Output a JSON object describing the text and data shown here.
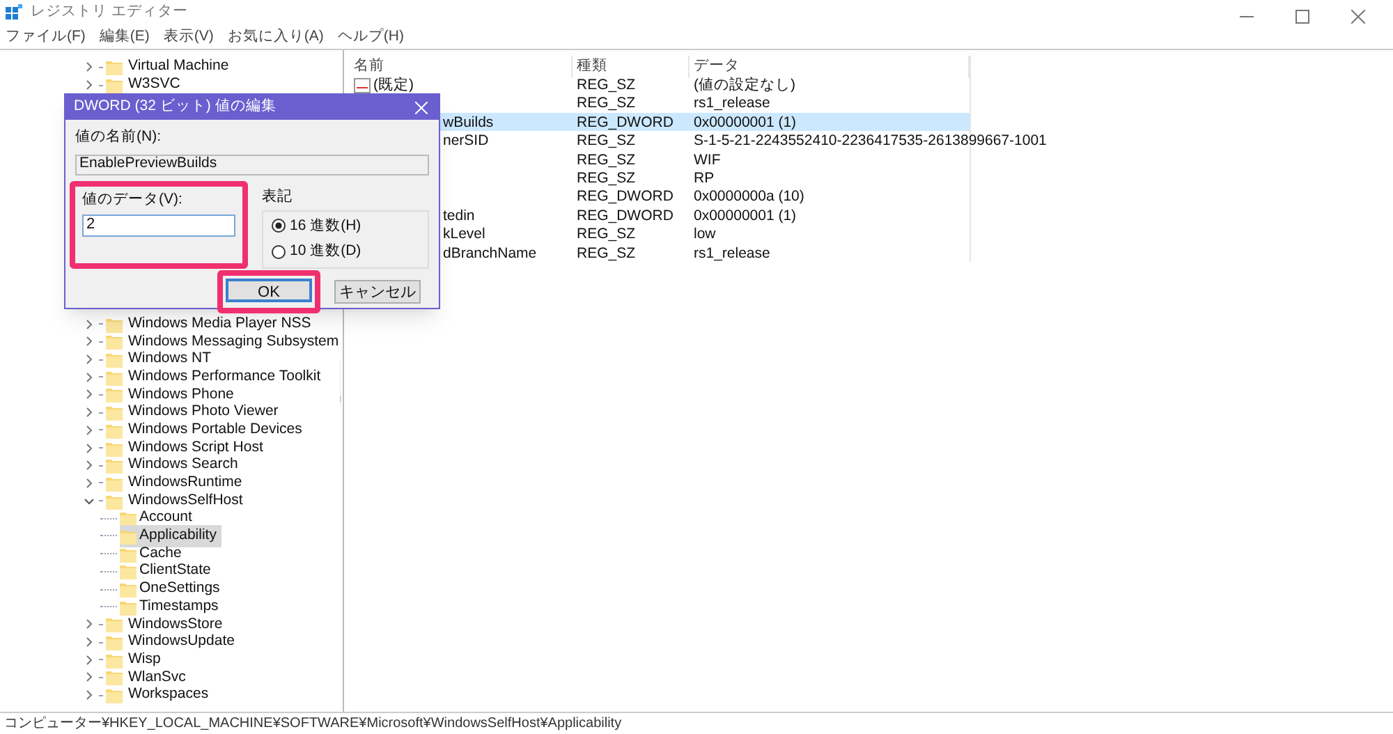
{
  "window": {
    "title": "レジストリ エディター"
  },
  "menu": [
    "ファイル(F)",
    "編集(E)",
    "表示(V)",
    "お気に入り(A)",
    "ヘルプ(H)"
  ],
  "tree": {
    "top_items": [
      {
        "label": "Virtual Machine",
        "expanded": false
      },
      {
        "label": "W3SVC",
        "expanded": false
      }
    ],
    "items": [
      {
        "label": "Windows Media Player NSS",
        "expanded": false
      },
      {
        "label": "Windows Messaging Subsystem",
        "expanded": false
      },
      {
        "label": "Windows NT",
        "expanded": false
      },
      {
        "label": "Windows Performance Toolkit",
        "expanded": false
      },
      {
        "label": "Windows Phone",
        "expanded": false
      },
      {
        "label": "Windows Photo Viewer",
        "expanded": false
      },
      {
        "label": "Windows Portable Devices",
        "expanded": false
      },
      {
        "label": "Windows Script Host",
        "expanded": false
      },
      {
        "label": "Windows Search",
        "expanded": false
      },
      {
        "label": "WindowsRuntime",
        "expanded": false
      },
      {
        "label": "WindowsSelfHost",
        "expanded": true,
        "children": [
          {
            "label": "Account",
            "selected": false
          },
          {
            "label": "Applicability",
            "selected": true
          },
          {
            "label": "Cache",
            "selected": false
          },
          {
            "label": "ClientState",
            "selected": false
          },
          {
            "label": "OneSettings",
            "selected": false
          },
          {
            "label": "Timestamps",
            "selected": false
          }
        ]
      },
      {
        "label": "WindowsStore",
        "expanded": false
      },
      {
        "label": "WindowsUpdate",
        "expanded": false
      },
      {
        "label": "Wisp",
        "expanded": false
      },
      {
        "label": "WlanSvc",
        "expanded": false
      },
      {
        "label": "Workspaces",
        "expanded": false
      }
    ]
  },
  "values": {
    "columns": [
      "名前",
      "種類",
      "データ"
    ],
    "rows": [
      {
        "name": "(既定)",
        "type": "REG_SZ",
        "data": "(値の設定なし)",
        "selected": false
      },
      {
        "type": "REG_SZ",
        "data": "rs1_release",
        "selected": false
      },
      {
        "name": "wBuilds",
        "type": "REG_DWORD",
        "data": "0x00000001 (1)",
        "selected": true
      },
      {
        "name": "nerSID",
        "type": "REG_SZ",
        "data": "S-1-5-21-2243552410-2236417535-2613899667-1001",
        "selected": false
      },
      {
        "type": "REG_SZ",
        "data": "WIF",
        "selected": false
      },
      {
        "type": "REG_SZ",
        "data": "RP",
        "selected": false
      },
      {
        "type": "REG_DWORD",
        "data": "0x0000000a (10)",
        "selected": false
      },
      {
        "name": "tedin",
        "type": "REG_DWORD",
        "data": "0x00000001 (1)",
        "selected": false
      },
      {
        "name": "kLevel",
        "type": "REG_SZ",
        "data": "low",
        "selected": false
      },
      {
        "name": "dBranchName",
        "type": "REG_SZ",
        "data": "rs1_release",
        "selected": false
      }
    ]
  },
  "dialog": {
    "title": "DWORD (32 ビット) 値の編集",
    "name_label": "値の名前(N):",
    "name_value": "EnablePreviewBuilds",
    "data_label": "値のデータ(V):",
    "data_value": "2",
    "data_highlighted": true,
    "base_label": "表記",
    "radios": [
      {
        "label": "16 進数(H)",
        "selected": true
      },
      {
        "label": "10 進数(D)",
        "selected": false
      }
    ],
    "buttons": [
      {
        "label": "OK",
        "highlighted": true
      },
      {
        "label": "キャンセル",
        "highlighted": false
      }
    ]
  },
  "status_bar": "コンピューター¥HKEY_LOCAL_MACHINE¥SOFTWARE¥Microsoft¥WindowsSelfHost¥Applicability"
}
